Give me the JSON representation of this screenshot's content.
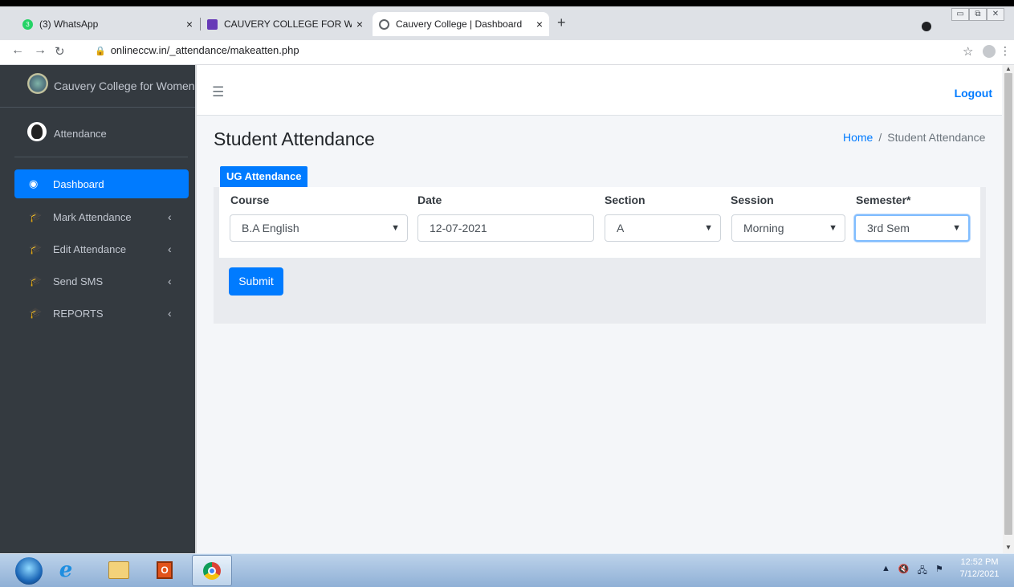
{
  "browser": {
    "tabs": [
      {
        "title": "(3) WhatsApp",
        "favicon": "whatsapp-icon",
        "favicon_text": "3",
        "color": "#25d366"
      },
      {
        "title": "CAUVERY COLLEGE FOR WOMEN",
        "favicon": "form-icon",
        "color": "#673ab7"
      },
      {
        "title": "Cauvery College | Dashboard",
        "favicon": "globe-icon",
        "color": "#5f6368"
      }
    ],
    "close_glyph": "×",
    "new_tab_glyph": "+",
    "url": "onlineccw.in/_attendance/makeatten.php"
  },
  "sidebar": {
    "brand": "Cauvery College for Women",
    "user_name": "Attendance",
    "items": [
      {
        "label": "Dashboard",
        "icon": "tachometer-icon",
        "active": true
      },
      {
        "label": "Mark Attendance",
        "icon": "graduation-cap-icon",
        "has_children": true
      },
      {
        "label": "Edit Attendance",
        "icon": "graduation-cap-icon",
        "has_children": true
      },
      {
        "label": "Send SMS",
        "icon": "graduation-cap-icon",
        "has_children": true
      },
      {
        "label": "REPORTS",
        "icon": "graduation-cap-icon",
        "has_children": true
      }
    ]
  },
  "topbar": {
    "logout": "Logout"
  },
  "content": {
    "title": "Student Attendance",
    "breadcrumb": {
      "home": "Home",
      "separator": "/",
      "current": "Student Attendance"
    },
    "tab_label": "UG Attendance",
    "form": {
      "course": {
        "label": "Course",
        "value": "B.A English"
      },
      "date": {
        "label": "Date",
        "value": "12-07-2021"
      },
      "section": {
        "label": "Section",
        "value": "A"
      },
      "session": {
        "label": "Session",
        "value": "Morning"
      },
      "semester": {
        "label": "Semester*",
        "value": "3rd Sem"
      }
    },
    "submit": "Submit"
  },
  "taskbar": {
    "time": "12:52 PM",
    "date": "7/12/2021"
  },
  "colors": {
    "primary": "#007bff",
    "sidebar": "#343a40"
  }
}
